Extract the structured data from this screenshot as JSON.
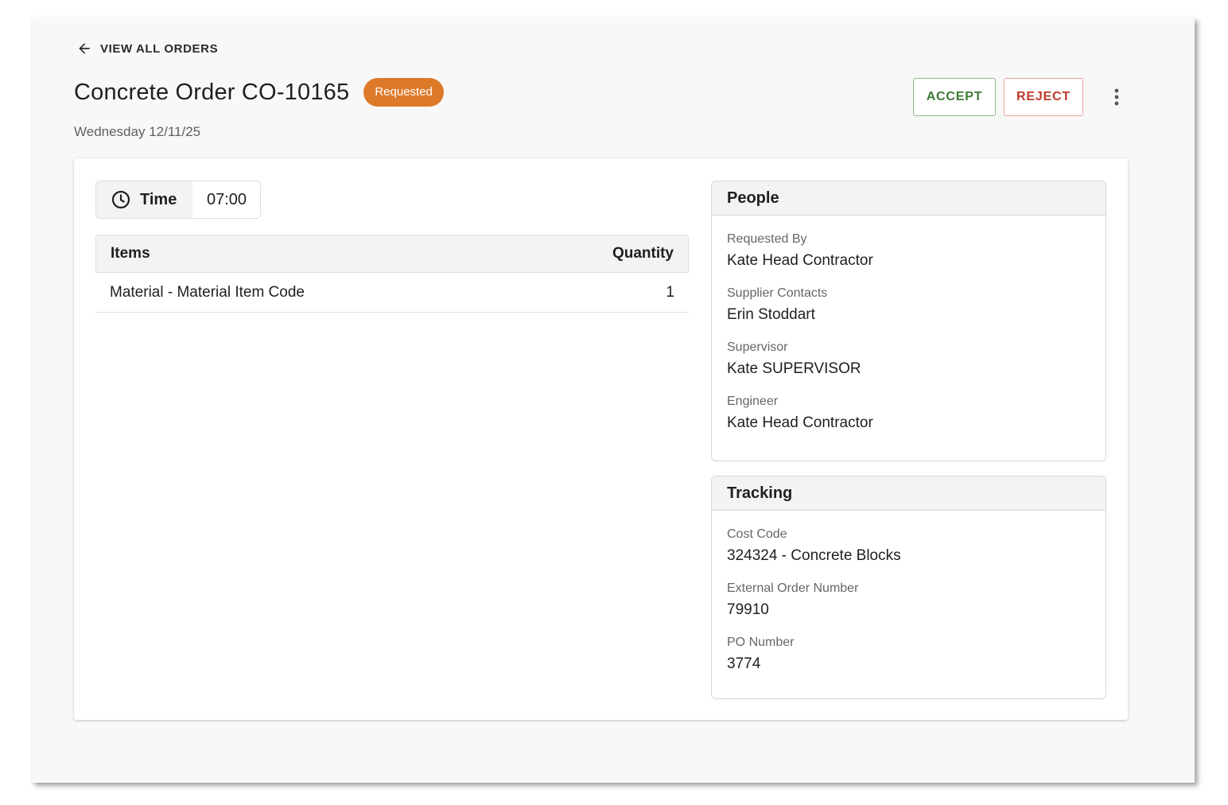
{
  "nav": {
    "back_label": "VIEW ALL ORDERS"
  },
  "order": {
    "title": "Concrete Order CO-10165",
    "status": "Requested",
    "date": "Wednesday 12/11/25"
  },
  "actions": {
    "accept_label": "ACCEPT",
    "reject_label": "REJECT"
  },
  "time": {
    "label": "Time",
    "value": "07:00"
  },
  "items_table": {
    "headers": [
      "Items",
      "Quantity"
    ],
    "rows": [
      {
        "item": "Material - Material Item Code",
        "quantity": "1"
      }
    ]
  },
  "people": {
    "title": "People",
    "fields": [
      {
        "label": "Requested By",
        "value": "Kate Head Contractor"
      },
      {
        "label": "Supplier Contacts",
        "value": "Erin Stoddart"
      },
      {
        "label": "Supervisor",
        "value": "Kate SUPERVISOR"
      },
      {
        "label": "Engineer",
        "value": "Kate Head Contractor"
      }
    ]
  },
  "tracking": {
    "title": "Tracking",
    "fields": [
      {
        "label": "Cost Code",
        "value": "324324 - Concrete Blocks"
      },
      {
        "label": "External Order Number",
        "value": "79910"
      },
      {
        "label": "PO Number",
        "value": "3774"
      }
    ]
  },
  "icons": {
    "back": "arrow-left-icon",
    "more": "more-vertical-icon",
    "time": "clock-icon"
  },
  "colors": {
    "status_badge": "#dd7a2a",
    "accept": "#3e7a35",
    "reject": "#c0392b",
    "background": "#f8f8f8"
  }
}
